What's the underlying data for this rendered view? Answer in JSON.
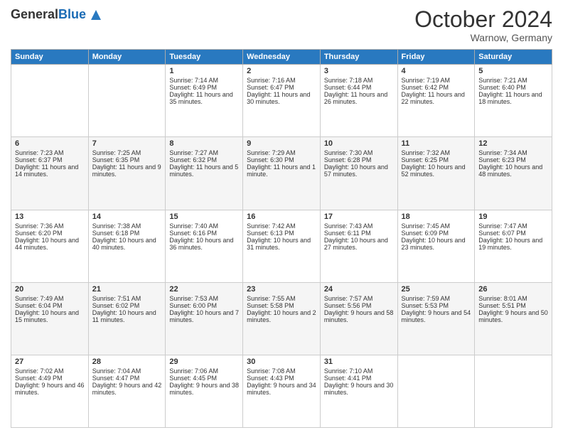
{
  "header": {
    "logo": {
      "general": "General",
      "blue": "Blue"
    },
    "title": "October 2024",
    "location": "Warnow, Germany"
  },
  "days_of_week": [
    "Sunday",
    "Monday",
    "Tuesday",
    "Wednesday",
    "Thursday",
    "Friday",
    "Saturday"
  ],
  "weeks": [
    [
      null,
      null,
      {
        "day": 1,
        "sunrise": "Sunrise: 7:14 AM",
        "sunset": "Sunset: 6:49 PM",
        "daylight": "Daylight: 11 hours and 35 minutes."
      },
      {
        "day": 2,
        "sunrise": "Sunrise: 7:16 AM",
        "sunset": "Sunset: 6:47 PM",
        "daylight": "Daylight: 11 hours and 30 minutes."
      },
      {
        "day": 3,
        "sunrise": "Sunrise: 7:18 AM",
        "sunset": "Sunset: 6:44 PM",
        "daylight": "Daylight: 11 hours and 26 minutes."
      },
      {
        "day": 4,
        "sunrise": "Sunrise: 7:19 AM",
        "sunset": "Sunset: 6:42 PM",
        "daylight": "Daylight: 11 hours and 22 minutes."
      },
      {
        "day": 5,
        "sunrise": "Sunrise: 7:21 AM",
        "sunset": "Sunset: 6:40 PM",
        "daylight": "Daylight: 11 hours and 18 minutes."
      }
    ],
    [
      {
        "day": 6,
        "sunrise": "Sunrise: 7:23 AM",
        "sunset": "Sunset: 6:37 PM",
        "daylight": "Daylight: 11 hours and 14 minutes."
      },
      {
        "day": 7,
        "sunrise": "Sunrise: 7:25 AM",
        "sunset": "Sunset: 6:35 PM",
        "daylight": "Daylight: 11 hours and 9 minutes."
      },
      {
        "day": 8,
        "sunrise": "Sunrise: 7:27 AM",
        "sunset": "Sunset: 6:32 PM",
        "daylight": "Daylight: 11 hours and 5 minutes."
      },
      {
        "day": 9,
        "sunrise": "Sunrise: 7:29 AM",
        "sunset": "Sunset: 6:30 PM",
        "daylight": "Daylight: 11 hours and 1 minute."
      },
      {
        "day": 10,
        "sunrise": "Sunrise: 7:30 AM",
        "sunset": "Sunset: 6:28 PM",
        "daylight": "Daylight: 10 hours and 57 minutes."
      },
      {
        "day": 11,
        "sunrise": "Sunrise: 7:32 AM",
        "sunset": "Sunset: 6:25 PM",
        "daylight": "Daylight: 10 hours and 52 minutes."
      },
      {
        "day": 12,
        "sunrise": "Sunrise: 7:34 AM",
        "sunset": "Sunset: 6:23 PM",
        "daylight": "Daylight: 10 hours and 48 minutes."
      }
    ],
    [
      {
        "day": 13,
        "sunrise": "Sunrise: 7:36 AM",
        "sunset": "Sunset: 6:20 PM",
        "daylight": "Daylight: 10 hours and 44 minutes."
      },
      {
        "day": 14,
        "sunrise": "Sunrise: 7:38 AM",
        "sunset": "Sunset: 6:18 PM",
        "daylight": "Daylight: 10 hours and 40 minutes."
      },
      {
        "day": 15,
        "sunrise": "Sunrise: 7:40 AM",
        "sunset": "Sunset: 6:16 PM",
        "daylight": "Daylight: 10 hours and 36 minutes."
      },
      {
        "day": 16,
        "sunrise": "Sunrise: 7:42 AM",
        "sunset": "Sunset: 6:13 PM",
        "daylight": "Daylight: 10 hours and 31 minutes."
      },
      {
        "day": 17,
        "sunrise": "Sunrise: 7:43 AM",
        "sunset": "Sunset: 6:11 PM",
        "daylight": "Daylight: 10 hours and 27 minutes."
      },
      {
        "day": 18,
        "sunrise": "Sunrise: 7:45 AM",
        "sunset": "Sunset: 6:09 PM",
        "daylight": "Daylight: 10 hours and 23 minutes."
      },
      {
        "day": 19,
        "sunrise": "Sunrise: 7:47 AM",
        "sunset": "Sunset: 6:07 PM",
        "daylight": "Daylight: 10 hours and 19 minutes."
      }
    ],
    [
      {
        "day": 20,
        "sunrise": "Sunrise: 7:49 AM",
        "sunset": "Sunset: 6:04 PM",
        "daylight": "Daylight: 10 hours and 15 minutes."
      },
      {
        "day": 21,
        "sunrise": "Sunrise: 7:51 AM",
        "sunset": "Sunset: 6:02 PM",
        "daylight": "Daylight: 10 hours and 11 minutes."
      },
      {
        "day": 22,
        "sunrise": "Sunrise: 7:53 AM",
        "sunset": "Sunset: 6:00 PM",
        "daylight": "Daylight: 10 hours and 7 minutes."
      },
      {
        "day": 23,
        "sunrise": "Sunrise: 7:55 AM",
        "sunset": "Sunset: 5:58 PM",
        "daylight": "Daylight: 10 hours and 2 minutes."
      },
      {
        "day": 24,
        "sunrise": "Sunrise: 7:57 AM",
        "sunset": "Sunset: 5:56 PM",
        "daylight": "Daylight: 9 hours and 58 minutes."
      },
      {
        "day": 25,
        "sunrise": "Sunrise: 7:59 AM",
        "sunset": "Sunset: 5:53 PM",
        "daylight": "Daylight: 9 hours and 54 minutes."
      },
      {
        "day": 26,
        "sunrise": "Sunrise: 8:01 AM",
        "sunset": "Sunset: 5:51 PM",
        "daylight": "Daylight: 9 hours and 50 minutes."
      }
    ],
    [
      {
        "day": 27,
        "sunrise": "Sunrise: 7:02 AM",
        "sunset": "Sunset: 4:49 PM",
        "daylight": "Daylight: 9 hours and 46 minutes."
      },
      {
        "day": 28,
        "sunrise": "Sunrise: 7:04 AM",
        "sunset": "Sunset: 4:47 PM",
        "daylight": "Daylight: 9 hours and 42 minutes."
      },
      {
        "day": 29,
        "sunrise": "Sunrise: 7:06 AM",
        "sunset": "Sunset: 4:45 PM",
        "daylight": "Daylight: 9 hours and 38 minutes."
      },
      {
        "day": 30,
        "sunrise": "Sunrise: 7:08 AM",
        "sunset": "Sunset: 4:43 PM",
        "daylight": "Daylight: 9 hours and 34 minutes."
      },
      {
        "day": 31,
        "sunrise": "Sunrise: 7:10 AM",
        "sunset": "Sunset: 4:41 PM",
        "daylight": "Daylight: 9 hours and 30 minutes."
      },
      null,
      null
    ]
  ]
}
